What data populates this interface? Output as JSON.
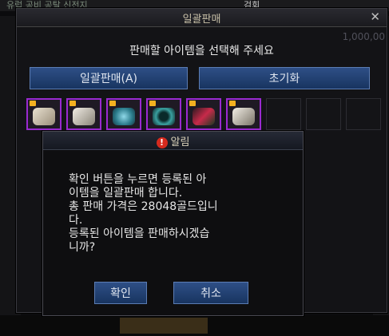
{
  "background": {
    "top_left_text": "유럽 공비 공탈 신전지",
    "top_right_text": "검회"
  },
  "window": {
    "title": "일괄판매",
    "close_glyph": "✕",
    "bg_amount": "1,000,00",
    "instruction": "판매할 아이템을 선택해 주세요",
    "bulk_sell_button": "일괄판매(A)",
    "reset_button": "초기화",
    "item_slots": [
      "gloves-item",
      "gauntlet-item",
      "bracelet-item",
      "ring-item",
      "necklace-item",
      "gauntlet-item-2"
    ]
  },
  "alert": {
    "title": "알림",
    "message_lines": [
      "확인 버튼을 누르면 등록된 아",
      "이템을 일괄판매 합니다.",
      "총 판매 가격은 28048골드입니",
      "다.",
      "등록된 아이템을 판매하시겠습",
      "니까?"
    ],
    "confirm_button": "확인",
    "cancel_button": "취소"
  },
  "colors": {
    "slot_border": "#9a2ad0",
    "button_blue": "#183460",
    "warning_red": "#d62a1e"
  }
}
